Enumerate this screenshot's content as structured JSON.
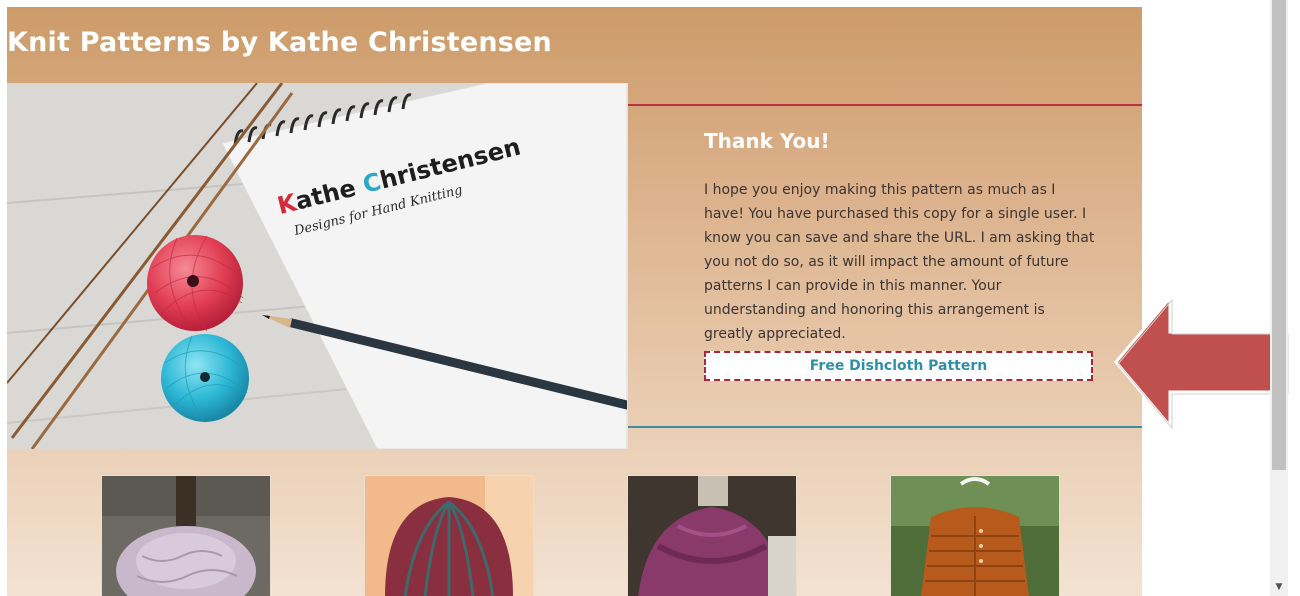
{
  "site": {
    "title": "Knit Patterns by Kathe Christensen"
  },
  "hero": {
    "logo_k": "K",
    "logo_mid": "athe ",
    "logo_c": "C",
    "logo_end": "hristensen",
    "tagline": "Designs for Hand Knitting"
  },
  "thank_you": {
    "title": "Thank You!",
    "text": "I hope you enjoy making this pattern as much as I have! You have purchased this copy for a single user. I know you can save and share the URL. I am asking that you not do so, as it will impact the amount of future patterns I can provide in this manner. Your understanding and honoring this arrangement is greatly appreciated.",
    "button_label": "Free Dishcloth Pattern"
  },
  "colors": {
    "accent_red": "#b8323f",
    "accent_blue": "#3a8ea5",
    "button_text": "#2f8fa8",
    "arrow": "#c0504d"
  },
  "thumbnails": [
    {
      "icon": "lace-cowl-photo"
    },
    {
      "icon": "striped-hat-photo"
    },
    {
      "icon": "plum-shawl-photo"
    },
    {
      "icon": "orange-cardigan-photo"
    }
  ]
}
